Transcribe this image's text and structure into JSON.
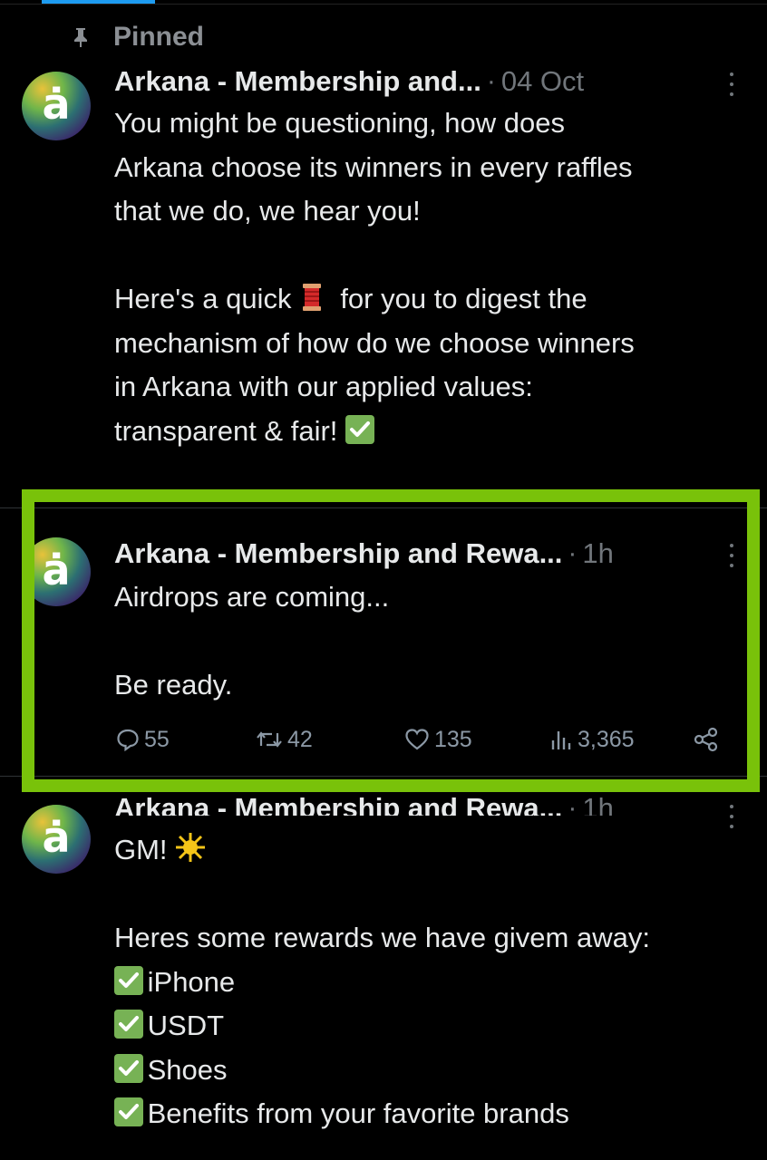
{
  "pinned_label": "Pinned",
  "colors": {
    "background": "#000000",
    "highlight_border": "#79c20a",
    "link_accent": "#1d9bf0",
    "muted_text": "#71767b"
  },
  "tweets": [
    {
      "author": "Arkana - Membership and...",
      "separator": "·",
      "time": "04 Oct",
      "avatar_letter": "ȧ",
      "paragraphs": [
        "You might be questioning, how does\nArkana choose its winners in every raffles\nthat we do, we hear you!",
        "Here's a quick",
        "for you to digest the\nmechanism of how do we choose winners\nin Arkana with our applied values:\ntransparent & fair!"
      ],
      "emojis": [
        "thread-spool-emoji",
        "check-mark-button-emoji"
      ]
    },
    {
      "author": "Arkana - Membership and Rewa...",
      "separator": "·",
      "time": "1h",
      "avatar_letter": "ȧ",
      "line1": "Airdrops are coming...",
      "line2": "Be ready.",
      "stats": {
        "replies": "55",
        "reposts": "42",
        "likes": "135",
        "views": "3,365"
      }
    },
    {
      "author": "Arkana - Membership and Rewa...",
      "separator": "·",
      "time": "1h",
      "avatar_letter": "ȧ",
      "greeting": "GM!",
      "intro": "Heres some rewards we have givem away:",
      "rewards": [
        "iPhone",
        "USDT",
        "Shoes",
        "Benefits from your favorite brands"
      ]
    }
  ]
}
